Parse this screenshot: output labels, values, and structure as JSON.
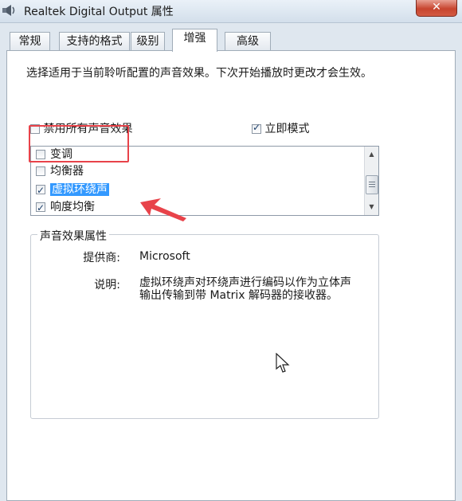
{
  "window": {
    "title": "Realtek Digital Output 属性",
    "close_label": "✕"
  },
  "tabs": [
    {
      "label": "常规"
    },
    {
      "label": "支持的格式"
    },
    {
      "label": "级别"
    },
    {
      "label": "增强"
    },
    {
      "label": "高级"
    }
  ],
  "active_tab": "增强",
  "intro_text": "选择适用于当前聆听配置的声音效果。下次开始播放时更改才会生效。",
  "options": {
    "disable_all": {
      "label": "禁用所有声音效果",
      "checked": false
    },
    "immediate_mode": {
      "label": "立即模式",
      "checked": true
    }
  },
  "effects": [
    {
      "label": "变调",
      "checked": false
    },
    {
      "label": "均衡器",
      "checked": false
    },
    {
      "label": "虚拟环绕声",
      "checked": true,
      "selected": true
    },
    {
      "label": "响度均衡",
      "checked": true
    }
  ],
  "properties": {
    "group_title": "声音效果属性",
    "provider_label": "提供商:",
    "provider_value": "Microsoft",
    "description_label": "说明:",
    "description_line1": "虚拟环绕声对环绕声进行编码以作为立体声",
    "description_line2": "输出传输到带 Matrix 解码器的接收器。"
  },
  "annotation_color": "#e8434a",
  "selection_color": "#3399ff"
}
